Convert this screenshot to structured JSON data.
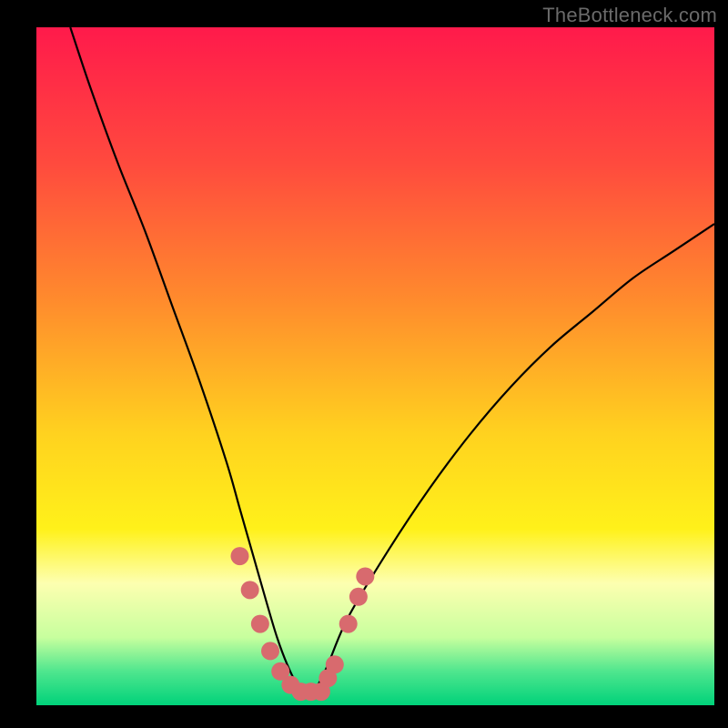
{
  "watermark": "TheBottleneck.com",
  "chart_data": {
    "type": "line",
    "title": "",
    "xlabel": "",
    "ylabel": "",
    "xlim": [
      0,
      100
    ],
    "ylim": [
      0,
      100
    ],
    "background_gradient": {
      "stops": [
        {
          "offset": 0.0,
          "color": "#ff1a4b"
        },
        {
          "offset": 0.2,
          "color": "#ff4a3e"
        },
        {
          "offset": 0.4,
          "color": "#ff8a2d"
        },
        {
          "offset": 0.6,
          "color": "#ffd21f"
        },
        {
          "offset": 0.74,
          "color": "#fff11a"
        },
        {
          "offset": 0.82,
          "color": "#fdffb0"
        },
        {
          "offset": 0.9,
          "color": "#c7ff9e"
        },
        {
          "offset": 0.95,
          "color": "#4fe68e"
        },
        {
          "offset": 1.0,
          "color": "#00d27a"
        }
      ]
    },
    "series": [
      {
        "name": "bottleneck-curve",
        "color": "#000000",
        "x": [
          5,
          8,
          12,
          16,
          20,
          24,
          28,
          30,
          32,
          34,
          35.5,
          37,
          38.5,
          40,
          41.5,
          43,
          46,
          52,
          58,
          64,
          70,
          76,
          82,
          88,
          94,
          100
        ],
        "y": [
          100,
          91,
          80,
          70,
          59,
          48,
          36,
          29,
          22,
          15,
          10,
          6,
          3,
          2,
          3,
          6,
          13,
          23,
          32,
          40,
          47,
          53,
          58,
          63,
          67,
          71
        ]
      }
    ],
    "highlight_points": {
      "name": "bottleneck-markers",
      "color": "#d86a6e",
      "radius": 10,
      "points": [
        {
          "x": 30.0,
          "y": 22
        },
        {
          "x": 31.5,
          "y": 17
        },
        {
          "x": 33.0,
          "y": 12
        },
        {
          "x": 34.5,
          "y": 8
        },
        {
          "x": 36.0,
          "y": 5
        },
        {
          "x": 37.5,
          "y": 3
        },
        {
          "x": 39.0,
          "y": 2
        },
        {
          "x": 40.5,
          "y": 2
        },
        {
          "x": 42.0,
          "y": 2
        },
        {
          "x": 43.0,
          "y": 4
        },
        {
          "x": 44.0,
          "y": 6
        },
        {
          "x": 46.0,
          "y": 12
        },
        {
          "x": 47.5,
          "y": 16
        },
        {
          "x": 48.5,
          "y": 19
        }
      ]
    }
  }
}
